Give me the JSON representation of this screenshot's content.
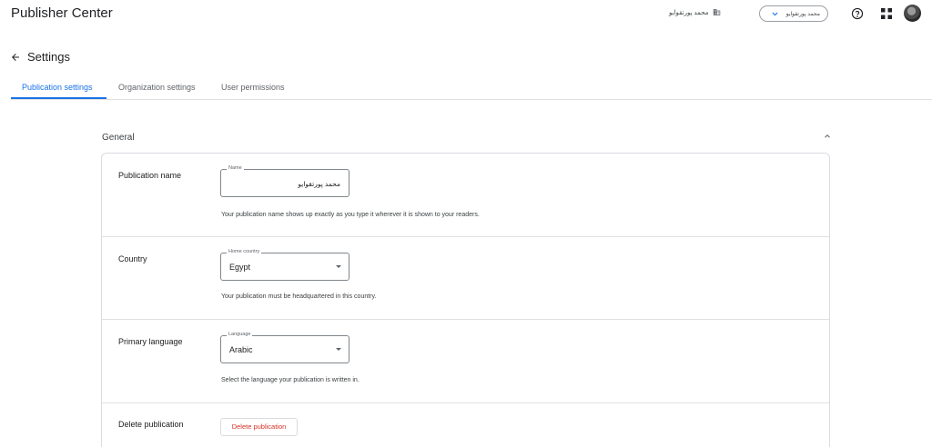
{
  "header": {
    "app_title": "Publisher Center",
    "publication_label": "محمد پورتقوایو",
    "publication_switcher": "محمد پورتقوایو",
    "icons": [
      "building-icon",
      "chevron-down-icon",
      "help-icon",
      "apps-grid-icon",
      "avatar"
    ]
  },
  "page": {
    "title": "Settings",
    "back_icon": "arrow-back-icon"
  },
  "tabs": [
    {
      "label": "Publication settings",
      "active": true
    },
    {
      "label": "Organization settings",
      "active": false
    },
    {
      "label": "User permissions",
      "active": false
    }
  ],
  "section": {
    "title": "General",
    "collapse_icon": "chevron-up-icon"
  },
  "rows": {
    "publication_name": {
      "label": "Publication name",
      "field_legend": "Name",
      "field_value": "محمد پورتقوایو",
      "helper": "Your publication name shows up exactly as you type it wherever it is shown to your readers."
    },
    "country": {
      "label": "Country",
      "field_legend": "Home country",
      "field_value": "Egypt",
      "helper": "Your publication must be headquartered in this country."
    },
    "language": {
      "label": "Primary language",
      "field_legend": "Language",
      "field_value": "Arabic",
      "helper": "Select the language your publication is written in."
    },
    "delete": {
      "label": "Delete publication",
      "button_label": "Delete publication"
    }
  },
  "colors": {
    "accent": "#1a73e8",
    "danger": "#d93025",
    "border": "#dadce0"
  }
}
